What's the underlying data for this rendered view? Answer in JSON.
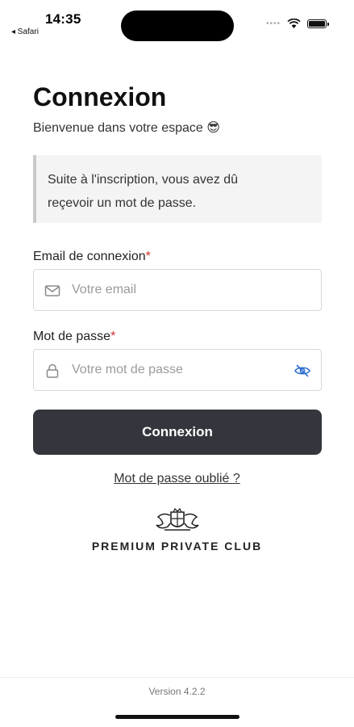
{
  "status_bar": {
    "time": "14:35",
    "back_app": "◂ Safari"
  },
  "login": {
    "title": "Connexion",
    "subtitle": "Bienvenue dans votre espace 😎",
    "info_line1": "Suite à l'inscription, vous avez dû",
    "info_line2": "reçevoir un mot de passe.",
    "email_label": "Email de connexion",
    "email_placeholder": "Votre email",
    "email_value": "",
    "password_label": "Mot de passe",
    "password_placeholder": "Votre mot de passe",
    "password_value": "",
    "required_marker": "*",
    "submit_label": "Connexion",
    "forgot_label": "Mot de passe oublié ?"
  },
  "brand": {
    "name": "PREMIUM PRIVATE CLUB"
  },
  "footer": {
    "version": "Version 4.2.2"
  },
  "colors": {
    "button_bg": "#33373d",
    "info_bg": "#f4f4f5",
    "info_border": "#c9c9cc",
    "required": "#d0302f",
    "eye_icon": "#2f6fd0"
  },
  "icons": [
    "wifi-icon",
    "battery-icon",
    "mail-icon",
    "lock-icon",
    "eye-off-icon",
    "club-crest-icon"
  ]
}
